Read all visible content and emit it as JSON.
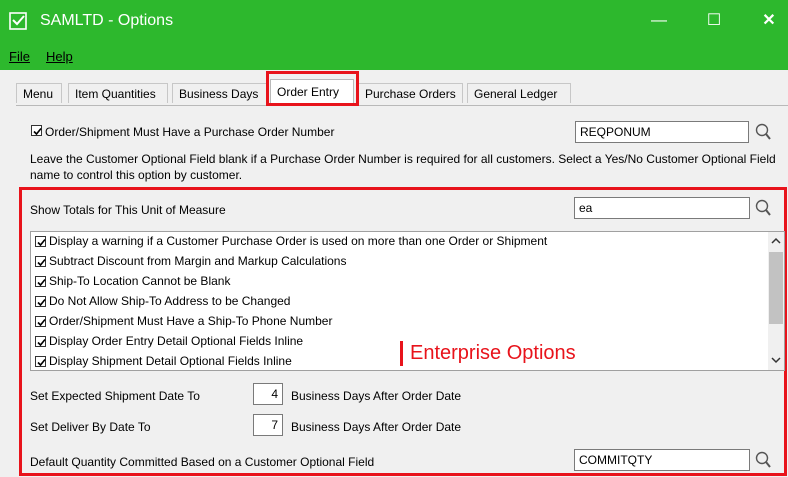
{
  "window": {
    "title": "SAMLTD - Options",
    "controls": {
      "minimize": "—",
      "maximize": "☐",
      "close": "✕"
    }
  },
  "menu": {
    "file": "File",
    "help": "Help"
  },
  "tabs": [
    {
      "label": "Menu"
    },
    {
      "label": "Item Quantities"
    },
    {
      "label": "Business Days"
    },
    {
      "label": "Order Entry"
    },
    {
      "label": "Purchase Orders"
    },
    {
      "label": "General Ledger"
    }
  ],
  "active_tab": "Order Entry",
  "po_option": {
    "label": "Order/Shipment Must Have a Purchase Order Number",
    "checked": true,
    "value": "REQPONUM",
    "note": "Leave the Customer Optional Field blank if a Purchase Order Number is required for all customers. Select a Yes/No Customer Optional Field name to control this option by customer."
  },
  "totals": {
    "label": "Show Totals for This Unit of Measure",
    "value": "ea"
  },
  "options_list": [
    {
      "label": "Display a warning if a Customer Purchase Order is used on more than one Order or Shipment",
      "checked": true
    },
    {
      "label": "Subtract Discount from Margin and Markup Calculations",
      "checked": true
    },
    {
      "label": "Ship-To Location Cannot be Blank",
      "checked": true
    },
    {
      "label": "Do Not Allow Ship-To Address to be Changed",
      "checked": true
    },
    {
      "label": "Order/Shipment Must Have a Ship-To Phone Number",
      "checked": true
    },
    {
      "label": "Display Order Entry Detail Optional Fields Inline",
      "checked": true
    },
    {
      "label": "Display Shipment Detail Optional Fields Inline",
      "checked": true
    }
  ],
  "annotation": "Enterprise Options",
  "expected_ship": {
    "label": "Set Expected Shipment Date To",
    "value": "4",
    "suffix": "Business Days After Order Date"
  },
  "deliver_by": {
    "label": "Set Deliver By Date To",
    "value": "7",
    "suffix": "Business Days After Order Date"
  },
  "committed": {
    "label": "Default Quantity Committed Based on a Customer Optional Field",
    "value": "COMMITQTY"
  },
  "colors": {
    "title_bar": "#2db82d",
    "highlight": "#e8131b"
  }
}
